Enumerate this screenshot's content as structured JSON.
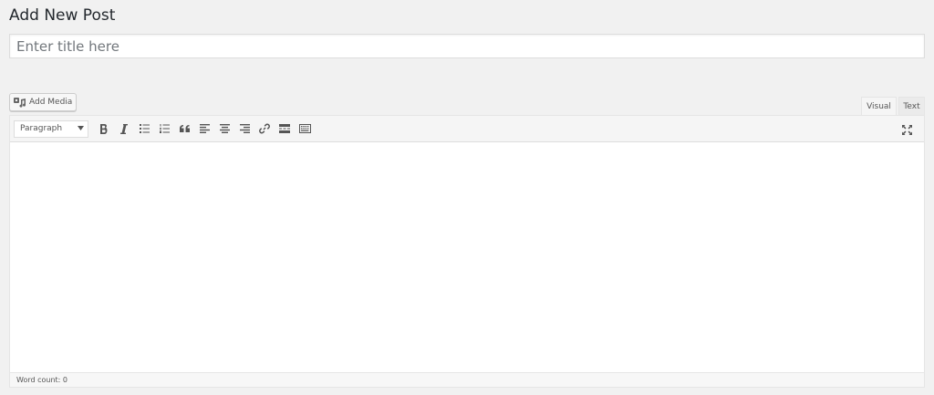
{
  "header": {
    "title": "Add New Post"
  },
  "title_field": {
    "placeholder": "Enter title here",
    "value": ""
  },
  "media": {
    "add_media_label": "Add Media"
  },
  "tabs": [
    {
      "label": "Visual",
      "active": true
    },
    {
      "label": "Text",
      "active": false
    }
  ],
  "toolbar": {
    "format_value": "Paragraph",
    "buttons": [
      "bold",
      "italic",
      "bulleted-list",
      "numbered-list",
      "blockquote",
      "align-left",
      "align-center",
      "align-right",
      "insert-link",
      "insert-read-more",
      "toolbar-toggle",
      "fullscreen"
    ]
  },
  "status": {
    "word_count": "Word count: 0"
  },
  "colors": {
    "background": "#f1f1f1",
    "border": "#dddddd",
    "text": "#23282d"
  }
}
